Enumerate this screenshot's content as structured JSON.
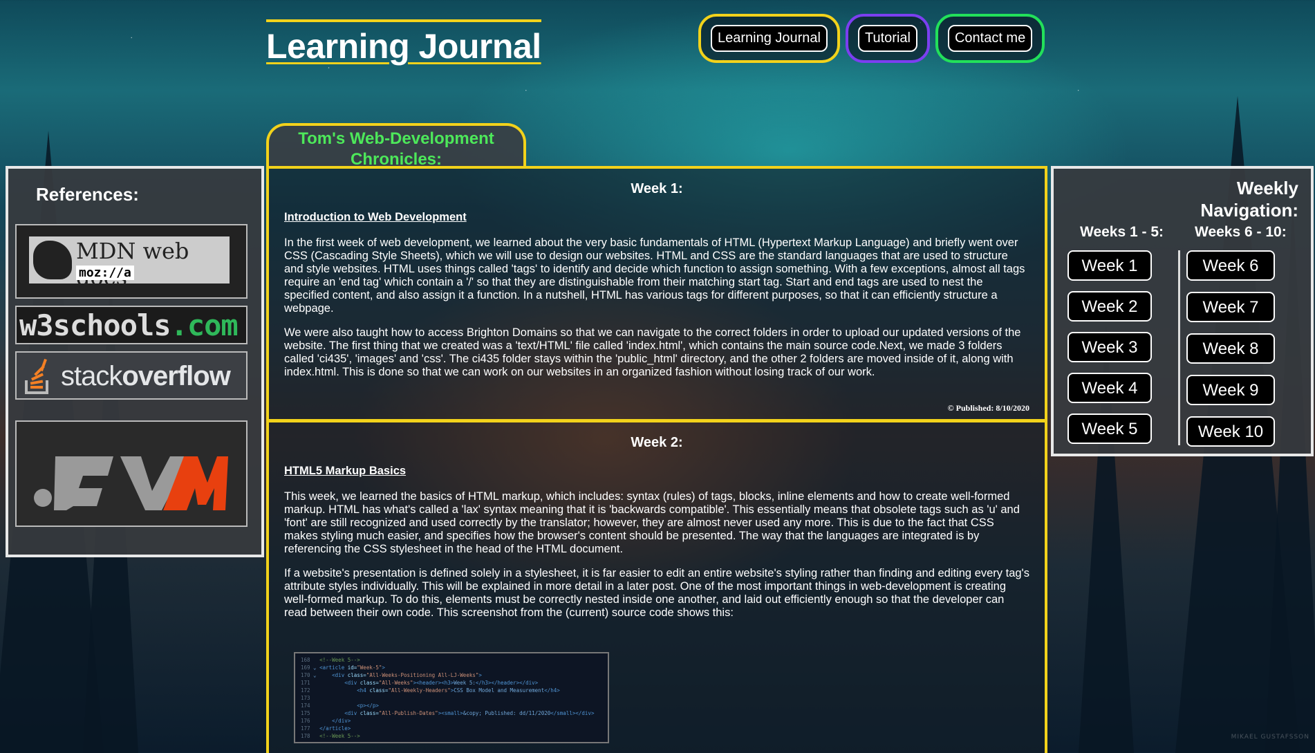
{
  "header": {
    "title": "Learning Journal",
    "nav": [
      "Learning Journal",
      "Tutorial",
      "Contact me"
    ]
  },
  "chronicles_title": "Tom's Web-Development Chronicles:",
  "references": {
    "heading": "References:",
    "mdn_text": "MDN web docs",
    "mdn_sub": "moz://a",
    "w3_text_a": "w3schools",
    "w3_text_b": ".com",
    "so_text_a": "stack",
    "so_text_b": "overflow"
  },
  "posts": [
    {
      "heading": "Week 1:",
      "subtitle": "Introduction to Web Development",
      "paragraphs": [
        "In the first week of web development, we learned about the very basic fundamentals of HTML (Hypertext Markup Language) and briefly went over CSS (Cascading Style Sheets), which we will use to design our websites. HTML and CSS are the standard languages that are used to structure and style websites. HTML uses things called 'tags' to identify and decide which function to assign something. With a few exceptions, almost all tags require an 'end tag' which contain a '/' so that they are distinguishable from their matching start tag. Start and end tags are used to nest the specified content, and also assign it a function. In a nutshell, HTML has various tags for different purposes, so that it can efficiently structure a webpage.",
        "We were also taught how to access Brighton Domains so that we can navigate to the correct folders in order to upload our updated versions of the website. The first thing that we created was a 'text/HTML' file called 'index.html', which contains the main source code.Next, we made 3 folders called 'ci435', 'images' and 'css'. The ci435 folder stays within the 'public_html' directory, and the other 2 folders are moved inside of it, along with index.html. This is done so that we can work on our websites in an organized fashion without losing track of our work."
      ],
      "published": "© Published: 8/10/2020"
    },
    {
      "heading": "Week 2:",
      "subtitle": "HTML5 Markup Basics",
      "paragraphs": [
        "This week, we learned the basics of HTML markup, which includes: syntax (rules) of tags, blocks, inline elements and how to create well-formed markup. HTML has what's called a 'lax' syntax meaning that it is 'backwards compatible'. This essentially means that obsolete tags such as 'u' and 'font' are still recognized and used correctly by the translator; however, they are almost never used any more. This is due to the fact that CSS makes styling much easier, and specifies how the browser's content should be presented. The way that the languages are integrated is by referencing the CSS stylesheet in the head of the HTML document.",
        "If a website's presentation is defined solely in a stylesheet, it is far easier to edit an entire website's styling rather than finding and editing every tag's attribute styles individually. This will be explained in more detail in a later post. One of the most important things in web-development is creating well-formed markup. To do this, elements must be correctly nested inside one another, and laid out efficiently enough so that the developer can read between their own code. This screenshot from the (current) source code shows this:"
      ]
    }
  ],
  "weekly_nav": {
    "heading_line1": "Weekly",
    "heading_line2": "Navigation:",
    "col1_head": "Weeks 1 - 5:",
    "col2_head": "Weeks 6 - 10:",
    "col1": [
      "Week 1",
      "Week 2",
      "Week 3",
      "Week 4",
      "Week 5"
    ],
    "col2": [
      "Week 6",
      "Week 7",
      "Week 8",
      "Week 9",
      "Week 10"
    ]
  },
  "watermark": "MIKAEL GUSTAFSSON",
  "colors": {
    "accent_yellow": "#f2d21b",
    "accent_purple": "#7b3ff0",
    "accent_green": "#22e05a",
    "chronicles_green": "#4de85a"
  }
}
